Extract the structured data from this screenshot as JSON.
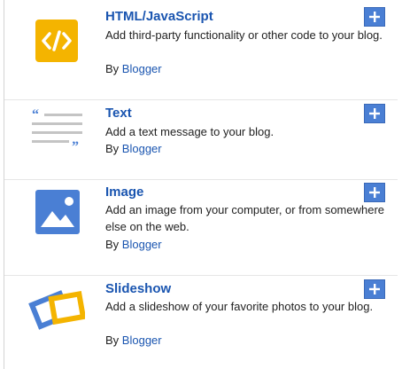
{
  "gadgets": [
    {
      "title": "HTML/JavaScript",
      "desc": "Add third-party functionality or other code to your blog.",
      "by_prefix": "By",
      "author": "Blogger",
      "icon": "code-icon"
    },
    {
      "title": "Text",
      "desc": "Add a text message to your blog.",
      "by_prefix": "By",
      "author": "Blogger",
      "icon": "text-quote-icon"
    },
    {
      "title": "Image",
      "desc": "Add an image from your computer, or from somewhere else on the web.",
      "by_prefix": "By",
      "author": "Blogger",
      "icon": "image-icon"
    },
    {
      "title": "Slideshow",
      "desc": "Add a slideshow of your favorite photos to your blog.",
      "by_prefix": "By",
      "author": "Blogger",
      "icon": "slideshow-icon"
    }
  ],
  "add_button_icon": "plus-icon",
  "colors": {
    "title_link": "#1a55b0",
    "add_button": "#4a7fd4",
    "html_icon_bg": "#f4b400",
    "image_icon_bg": "#4a7fd4",
    "text_icon_lines": "#c4c4c4",
    "text_icon_quotes": "#4a7fd4",
    "slideshow_blue": "#4a7fd4",
    "slideshow_yellow": "#f4b400"
  }
}
